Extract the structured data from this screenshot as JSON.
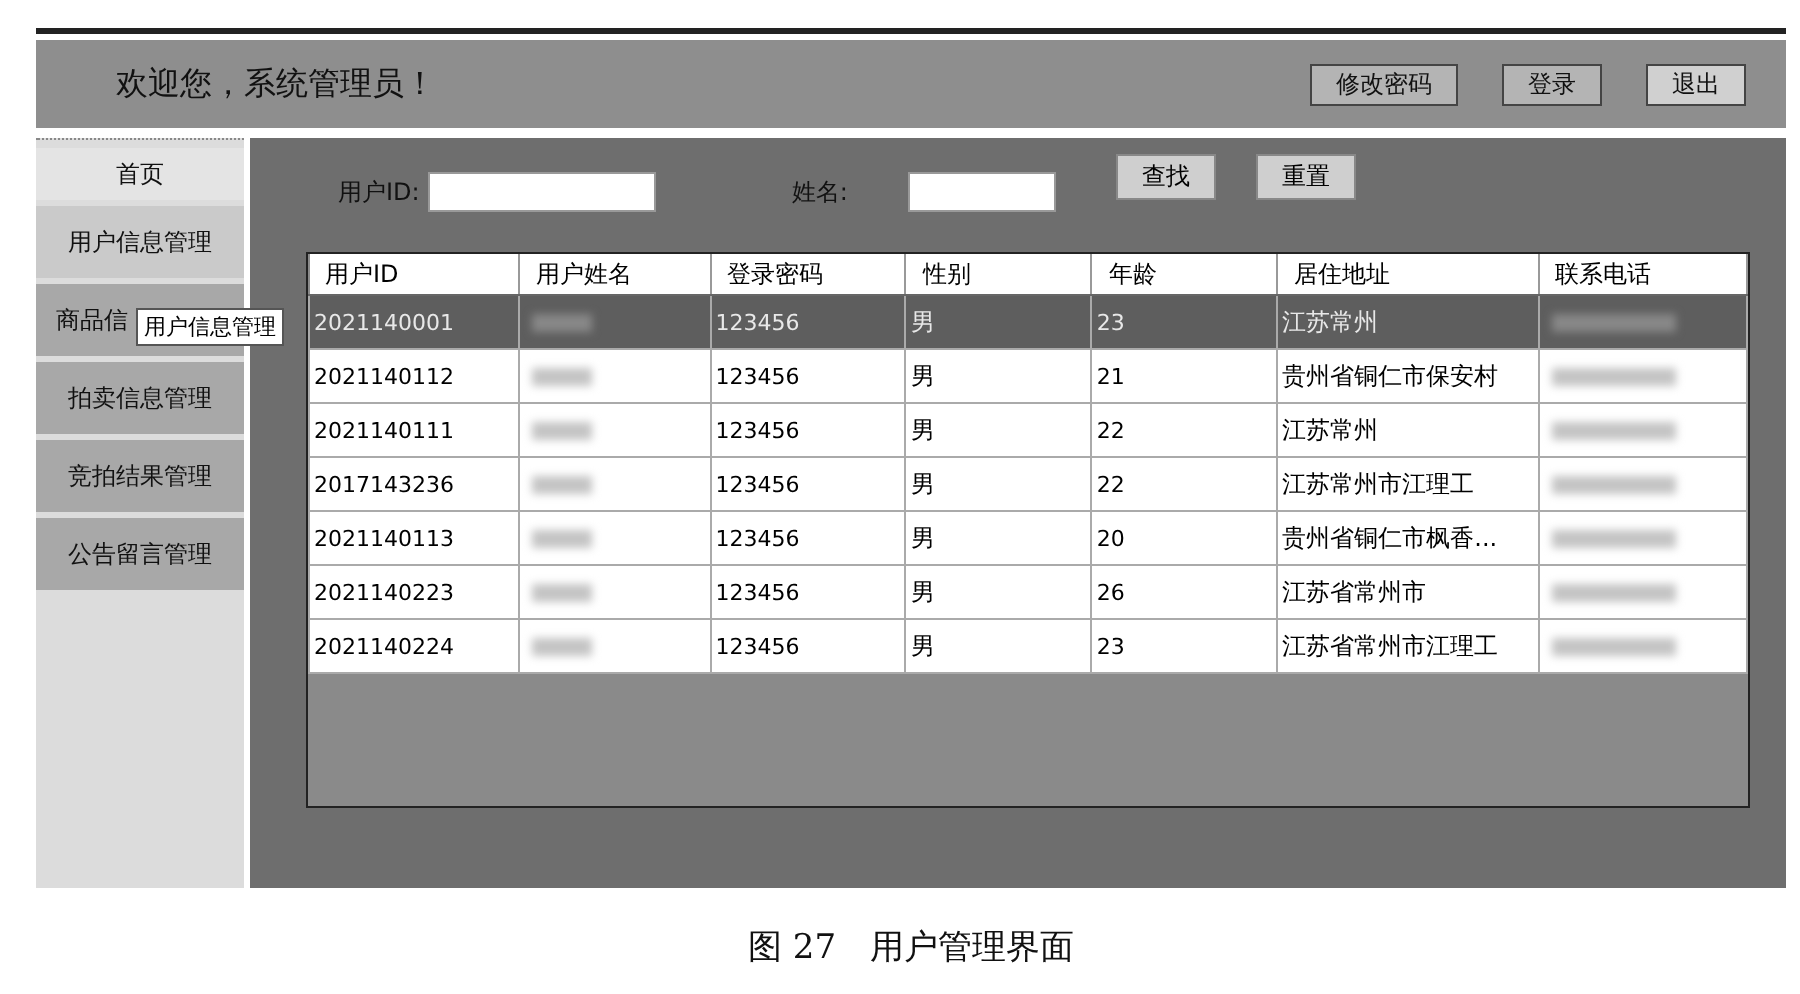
{
  "header": {
    "welcome": "欢迎您，系统管理员！",
    "buttons": [
      "修改密码",
      "登录",
      "退出"
    ]
  },
  "sidebar": {
    "items": [
      {
        "label": "首页",
        "kind": "home",
        "selected": false
      },
      {
        "label": "用户信息管理",
        "kind": "menu",
        "selected": true
      },
      {
        "label": "商品信",
        "kind": "menu",
        "selected": false
      },
      {
        "label": "拍卖信息管理",
        "kind": "menu",
        "selected": false
      },
      {
        "label": "竞拍结果管理",
        "kind": "menu",
        "selected": false
      },
      {
        "label": "公告留言管理",
        "kind": "menu",
        "selected": false
      }
    ],
    "tooltip": "用户信息管理"
  },
  "search": {
    "user_id_label": "用户ID:",
    "name_label": "姓名:",
    "buttons": [
      "查找",
      "重置"
    ]
  },
  "table": {
    "columns": [
      "用户ID",
      "用户姓名",
      "登录密码",
      "性别",
      "年龄",
      "居住地址",
      "联系电话"
    ],
    "rows": [
      {
        "selected": true,
        "cells": [
          "2021140001",
          {
            "redacted": true
          },
          "123456",
          "男",
          "23",
          "江苏常州",
          {
            "redacted": true
          }
        ]
      },
      {
        "selected": false,
        "cells": [
          "2021140112",
          {
            "redacted": true
          },
          "123456",
          "男",
          "21",
          "贵州省铜仁市保安村",
          {
            "redacted": true
          }
        ]
      },
      {
        "selected": false,
        "cells": [
          "2021140111",
          {
            "redacted": true
          },
          "123456",
          "男",
          "22",
          "江苏常州",
          {
            "redacted": true
          }
        ]
      },
      {
        "selected": false,
        "cells": [
          "2017143236",
          {
            "redacted": true
          },
          "123456",
          "男",
          "22",
          "江苏常州市江理工",
          {
            "redacted": true
          }
        ]
      },
      {
        "selected": false,
        "cells": [
          "2021140113",
          {
            "redacted": true
          },
          "123456",
          "男",
          "20",
          "贵州省铜仁市枫香...",
          {
            "redacted": true
          }
        ]
      },
      {
        "selected": false,
        "cells": [
          "2021140223",
          {
            "redacted": true
          },
          "123456",
          "男",
          "26",
          "江苏省常州市",
          {
            "redacted": true
          }
        ]
      },
      {
        "selected": false,
        "cells": [
          "2021140224",
          {
            "redacted": true
          },
          "123456",
          "男",
          "23",
          "江苏省常州市江理工",
          {
            "redacted": true
          }
        ]
      }
    ]
  },
  "caption": "图 27　用户管理界面"
}
